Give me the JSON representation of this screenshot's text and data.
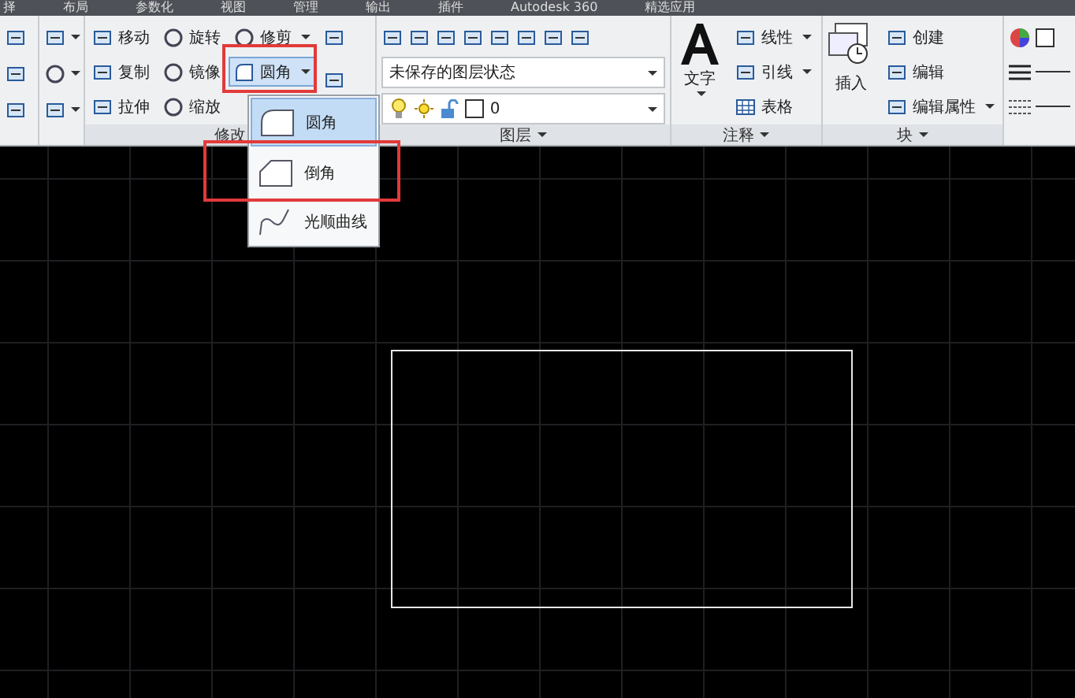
{
  "tabs": [
    {
      "label": "择"
    },
    {
      "label": "布局"
    },
    {
      "label": "参数化"
    },
    {
      "label": "视图"
    },
    {
      "label": "管理"
    },
    {
      "label": "输出"
    },
    {
      "label": "插件"
    },
    {
      "label": "Autodesk 360"
    },
    {
      "label": "精选应用"
    }
  ],
  "modify_panel": {
    "title": "修改",
    "columns": [
      [
        {
          "label": "移动",
          "dropdown": false,
          "highlighted": false
        },
        {
          "label": "复制",
          "dropdown": false,
          "highlighted": false
        },
        {
          "label": "拉伸",
          "dropdown": false,
          "highlighted": false
        }
      ],
      [
        {
          "label": "旋转",
          "dropdown": false,
          "highlighted": false
        },
        {
          "label": "镜像",
          "dropdown": false,
          "highlighted": false
        },
        {
          "label": "缩放",
          "dropdown": false,
          "highlighted": false
        }
      ],
      [
        {
          "label": "修剪",
          "dropdown": true,
          "highlighted": false
        },
        {
          "label": "圆角",
          "dropdown": true,
          "highlighted": true
        }
      ]
    ]
  },
  "fillet_menu": [
    {
      "label": "圆角",
      "selected": true,
      "highlighted": false
    },
    {
      "label": "倒角",
      "selected": false,
      "highlighted": true
    },
    {
      "label": "光顺曲线",
      "selected": false,
      "highlighted": false
    }
  ],
  "layer_panel": {
    "title": "图层",
    "layer_state": "未保存的图层状态",
    "current_layer": "0"
  },
  "annotation_panel": {
    "title": "注释",
    "big_tool": "文字",
    "tools": [
      {
        "label": "线性",
        "dropdown": true
      },
      {
        "label": "引线",
        "dropdown": true
      },
      {
        "label": "表格",
        "dropdown": false
      }
    ]
  },
  "block_panel": {
    "title": "块",
    "big_tool": "插入",
    "tools": [
      {
        "label": "创建",
        "dropdown": false
      },
      {
        "label": "编辑",
        "dropdown": false
      },
      {
        "label": "编辑属性",
        "dropdown": true
      }
    ]
  }
}
